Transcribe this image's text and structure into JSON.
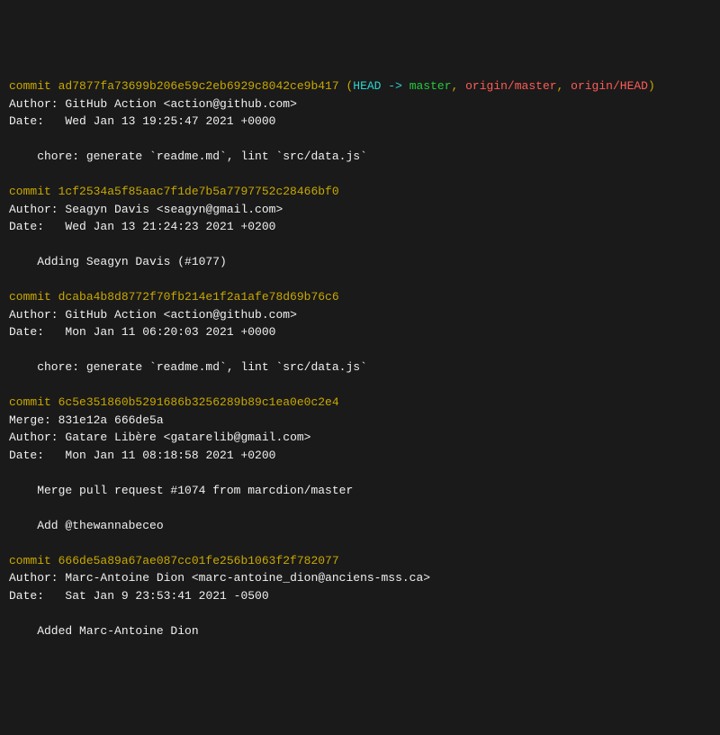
{
  "labels": {
    "commit": "commit ",
    "author": "Author: ",
    "date": "Date:   ",
    "merge": "Merge: "
  },
  "refs": {
    "open": " (",
    "head": "HEAD -> ",
    "master": "master",
    "sep": ", ",
    "origin_master": "origin/master",
    "origin_head": "origin/HEAD",
    "close": ")"
  },
  "commits": [
    {
      "hash": "ad7877fa73699b206e59c2eb6929c8042ce9b417",
      "author": "GitHub Action <action@github.com>",
      "date": "Wed Jan 13 19:25:47 2021 +0000",
      "msg1": "    chore: generate `readme.md`, lint `src/data.js`"
    },
    {
      "hash": "1cf2534a5f85aac7f1de7b5a7797752c28466bf0",
      "author": "Seagyn Davis <seagyn@gmail.com>",
      "date": "Wed Jan 13 21:24:23 2021 +0200",
      "msg1": "    Adding Seagyn Davis (#1077)"
    },
    {
      "hash": "dcaba4b8d8772f70fb214e1f2a1afe78d69b76c6",
      "author": "GitHub Action <action@github.com>",
      "date": "Mon Jan 11 06:20:03 2021 +0000",
      "msg1": "    chore: generate `readme.md`, lint `src/data.js`"
    },
    {
      "hash": "6c5e351860b5291686b3256289b89c1ea0e0c2e4",
      "merge": "831e12a 666de5a",
      "author": "Gatare Libère <gatarelib@gmail.com>",
      "date": "Mon Jan 11 08:18:58 2021 +0200",
      "msg1": "    Merge pull request #1074 from marcdion/master",
      "msg2": "    Add @thewannabeceo"
    },
    {
      "hash": "666de5a89a67ae087cc01fe256b1063f2f782077",
      "author": "Marc-Antoine Dion <marc-antoine_dion@anciens-mss.ca>",
      "date": "Sat Jan 9 23:53:41 2021 -0500",
      "msg1": "    Added Marc-Antoine Dion"
    }
  ]
}
